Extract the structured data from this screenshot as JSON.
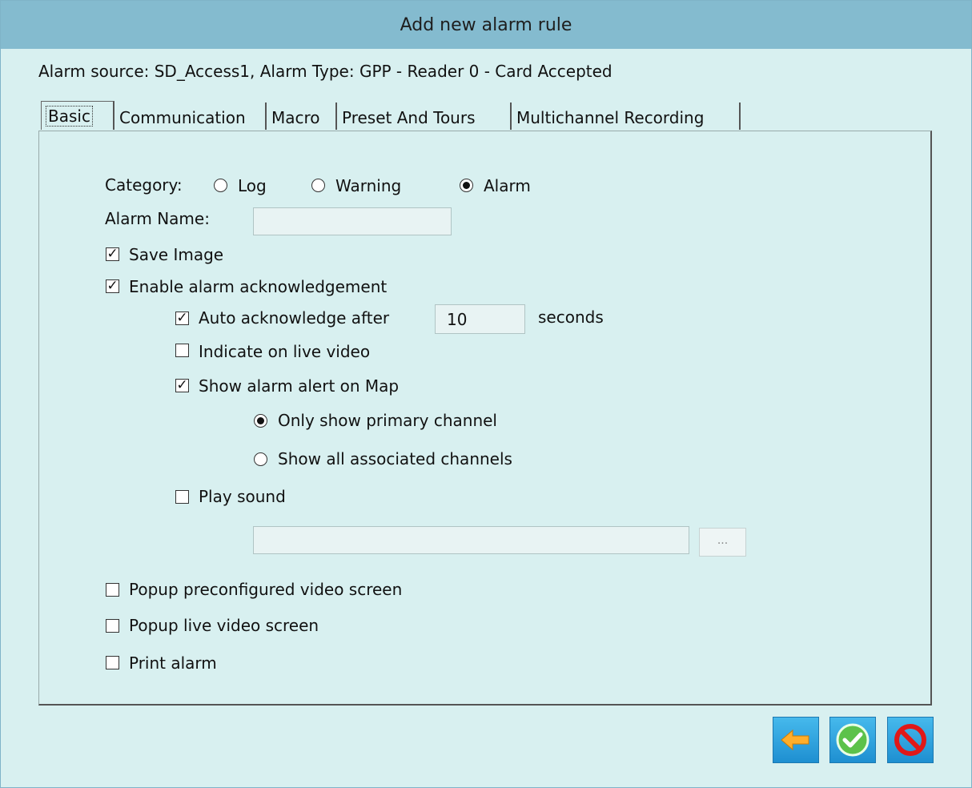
{
  "window": {
    "title": "Add new alarm rule"
  },
  "source_text": "Alarm source: SD_Access1, Alarm Type: GPP - Reader 0 - Card Accepted",
  "tabs": [
    {
      "label": "Basic",
      "active": true
    },
    {
      "label": "Communication",
      "active": false
    },
    {
      "label": "Macro",
      "active": false
    },
    {
      "label": "Preset And Tours",
      "active": false
    },
    {
      "label": "Multichannel Recording",
      "active": false
    }
  ],
  "basic": {
    "category_label": "Category:",
    "category_options": [
      {
        "label": "Log",
        "selected": false
      },
      {
        "label": "Warning",
        "selected": false
      },
      {
        "label": "Alarm",
        "selected": true
      }
    ],
    "alarm_name_label": "Alarm Name:",
    "alarm_name_value": "",
    "save_image": {
      "label": "Save Image",
      "checked": true
    },
    "enable_ack": {
      "label": "Enable alarm acknowledgement",
      "checked": true
    },
    "auto_ack": {
      "label": "Auto acknowledge after",
      "checked": true,
      "value": "10",
      "unit": "seconds"
    },
    "indicate_live": {
      "label": "Indicate on live video",
      "checked": false
    },
    "show_map": {
      "label": "Show alarm alert on Map",
      "checked": true
    },
    "map_options": [
      {
        "label": "Only show primary channel",
        "selected": true
      },
      {
        "label": "Show all associated channels",
        "selected": false
      }
    ],
    "play_sound": {
      "label": "Play sound",
      "checked": false
    },
    "sound_path": "",
    "browse_label": "...",
    "popup_preconfigured": {
      "label": "Popup preconfigured video screen",
      "checked": false
    },
    "popup_live": {
      "label": "Popup live video screen",
      "checked": false
    },
    "print_alarm": {
      "label": "Print alarm",
      "checked": false
    }
  },
  "buttons": {
    "back_icon": "arrow-left-icon",
    "ok_icon": "checkmark-icon",
    "cancel_icon": "prohibited-icon"
  },
  "colors": {
    "titlebar": "#84bbcf",
    "background": "#d8f0f0",
    "button_blue": "#1e8fd1"
  }
}
